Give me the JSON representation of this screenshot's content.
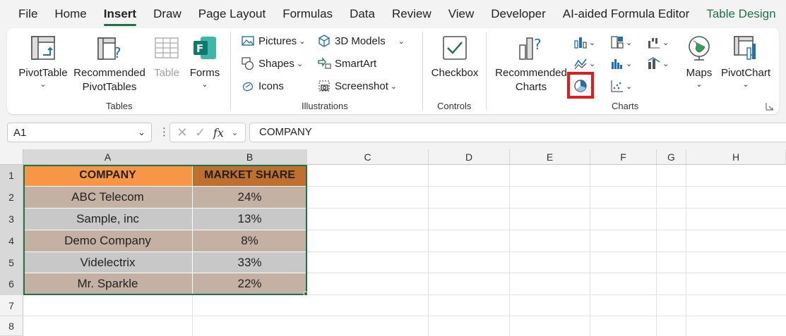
{
  "menu": {
    "tabs": [
      "File",
      "Home",
      "Insert",
      "Draw",
      "Page Layout",
      "Formulas",
      "Data",
      "Review",
      "View",
      "Developer",
      "AI-aided Formula Editor",
      "Table Design"
    ],
    "active": "Insert"
  },
  "ribbon": {
    "tables": {
      "pivot_table": "PivotTable",
      "recommended_pivot_line1": "Recommended",
      "recommended_pivot_line2": "PivotTables",
      "table": "Table",
      "forms": "Forms",
      "group_label": "Tables"
    },
    "illustrations": {
      "pictures": "Pictures",
      "shapes": "Shapes",
      "icons": "Icons",
      "models_3d": "3D Models",
      "smartart": "SmartArt",
      "screenshot": "Screenshot",
      "group_label": "Illustrations"
    },
    "controls": {
      "checkbox": "Checkbox",
      "group_label": "Controls"
    },
    "charts": {
      "recommended_line1": "Recommended",
      "recommended_line2": "Charts",
      "maps": "Maps",
      "pivot_chart": "PivotChart",
      "group_label": "Charts"
    }
  },
  "formula_bar": {
    "name_box": "A1",
    "fx_label": "fx",
    "content": "COMPANY"
  },
  "sheet": {
    "columns": [
      "A",
      "B",
      "C",
      "D",
      "E",
      "F",
      "G",
      "H"
    ],
    "rows": [
      "1",
      "2",
      "3",
      "4",
      "5",
      "6",
      "7",
      "8"
    ],
    "header": [
      "COMPANY",
      "MARKET SHARE"
    ],
    "data": [
      [
        "ABC Telecom",
        "24%"
      ],
      [
        "Sample, inc",
        "13%"
      ],
      [
        "Demo Company",
        "8%"
      ],
      [
        "Videlectrix",
        "33%"
      ],
      [
        "Mr. Sparkle",
        "22%"
      ]
    ]
  },
  "colors": {
    "accent_green": "#1f7244",
    "header_a": "#f79646",
    "header_b": "#c0702e",
    "row_tan": "#c4b1a4",
    "row_gray": "#c8c8c8",
    "highlight_red": "#e21b1b"
  }
}
